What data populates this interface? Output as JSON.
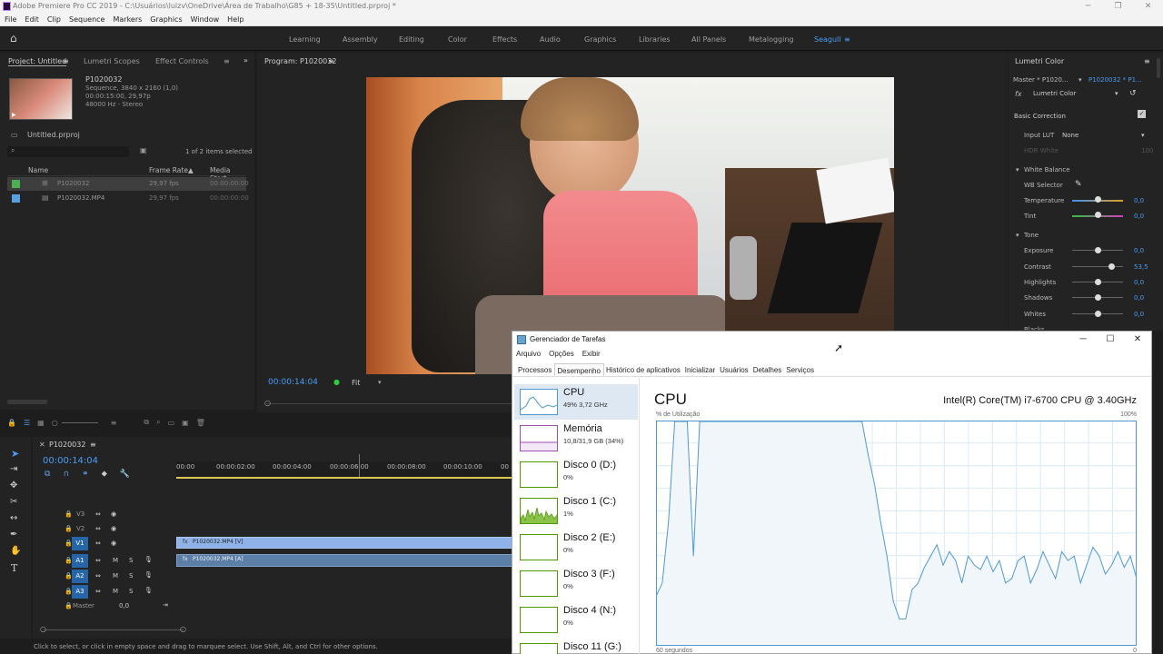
{
  "window": {
    "title": "Adobe Premiere Pro CC 2019 - C:\\Usuários\\luizv\\OneDrive\\Área de Trabalho\\G85 + 18-35\\Untitled.prproj *"
  },
  "menu": [
    "File",
    "Edit",
    "Clip",
    "Sequence",
    "Markers",
    "Graphics",
    "Window",
    "Help"
  ],
  "workspaces": [
    "Learning",
    "Assembly",
    "Editing",
    "Color",
    "Effects",
    "Audio",
    "Graphics",
    "Libraries",
    "All Panels",
    "Metalogging",
    "Seagull"
  ],
  "project": {
    "tabs": [
      "Project: Untitled",
      "Lumetri Scopes",
      "Effect Controls"
    ],
    "clip_name": "P1020032",
    "clip_info": [
      "Sequence, 3840 x 2160 (1,0)",
      "00:00:15:00, 29,97p",
      "48000 Hz - Stereo"
    ],
    "file": "Untitled.prproj",
    "items_selected": "1 of 2 items selected",
    "columns": {
      "name": "Name",
      "frame_rate": "Frame Rate",
      "media_start": "Media Start"
    },
    "rows": [
      {
        "name": "P1020032",
        "fps": "29,97 fps",
        "start": "00:00:00:00",
        "color": "#4caf50"
      },
      {
        "name": "P1020032.MP4",
        "fps": "29,97 fps",
        "start": "00:00:00:00",
        "color": "#5aa0e0"
      }
    ]
  },
  "program": {
    "tab": "Program: P1020032",
    "timecode": "00:00:14:04",
    "fit": "Fit"
  },
  "lumetri": {
    "tab": "Lumetri Color",
    "master": "Master * P1020...",
    "clip": "P1020032 * P1...",
    "fx": "Lumetri Color",
    "basic": "Basic Correction",
    "input_lut_label": "Input LUT",
    "input_lut_value": "None",
    "hdr_white": "HDR White",
    "hdr_value": "100",
    "white_balance": "White Balance",
    "wb_selector": "WB Selector",
    "temperature": {
      "label": "Temperature",
      "value": "0,0"
    },
    "tint": {
      "label": "Tint",
      "value": "0,0"
    },
    "tone": "Tone",
    "exposure": {
      "label": "Exposure",
      "value": "0,0"
    },
    "contrast": {
      "label": "Contrast",
      "value": "53,5"
    },
    "highlights": {
      "label": "Highlights",
      "value": "0,0"
    },
    "shadows": {
      "label": "Shadows",
      "value": "0,0"
    },
    "whites": {
      "label": "Whites",
      "value": "0,0"
    },
    "blacks": {
      "label": "Blacks",
      "value": ""
    }
  },
  "timeline": {
    "tab": "P1020032",
    "timecode": "00:00:14:04",
    "ruler": [
      "00:00",
      "00:00:02:00",
      "00:00:04:00",
      "00:00:06:00",
      "00:00:08:00",
      "00:00:10:00",
      "00"
    ],
    "video_tracks": [
      "V3",
      "V2",
      "V1"
    ],
    "audio_tracks": [
      "A1",
      "A2",
      "A3"
    ],
    "master": "Master",
    "master_value": "0,0",
    "video_clip": "P1020032.MP4 [V]",
    "audio_clip": "P1020032.MP4 [A]"
  },
  "status": "Click to select, or click in empty space and drag to marquee select. Use Shift, Alt, and Ctrl for other options.",
  "taskmgr": {
    "title": "Gerenciador de Tarefas",
    "menu": [
      "Arquivo",
      "Opções",
      "Exibir"
    ],
    "tabs": [
      "Processos",
      "Desempenho",
      "Histórico de aplicativos",
      "Inicializar",
      "Usuários",
      "Detalhes",
      "Serviços"
    ],
    "active_tab": 1,
    "resources": [
      {
        "name": "CPU",
        "sub": "49% 3,72 GHz",
        "color": "#4f98d1"
      },
      {
        "name": "Memória",
        "sub": "10,8/31,9 GB (34%)",
        "color": "#9b4fb0"
      },
      {
        "name": "Disco 0 (D:)",
        "sub": "0%",
        "color": "#4e9a06"
      },
      {
        "name": "Disco 1 (C:)",
        "sub": "1%",
        "color": "#4e9a06"
      },
      {
        "name": "Disco 2 (E:)",
        "sub": "0%",
        "color": "#4e9a06"
      },
      {
        "name": "Disco 3 (F:)",
        "sub": "0%",
        "color": "#4e9a06"
      },
      {
        "name": "Disco 4 (N:)",
        "sub": "0%",
        "color": "#4e9a06"
      },
      {
        "name": "Disco 11 (G:)",
        "sub": "",
        "color": "#4e9a06"
      }
    ],
    "cpu_title": "CPU",
    "cpu_model": "Intel(R) Core(TM) i7-6700 CPU @ 3.40GHz",
    "util_label": "% de Utilização",
    "max_label": "100%",
    "time_label": "60 segundos",
    "min_label": "0",
    "graph_series": [
      22,
      28,
      55,
      100,
      100,
      100,
      40,
      100,
      100,
      100,
      100,
      100,
      100,
      100,
      100,
      100,
      100,
      100,
      100,
      100,
      100,
      100,
      100,
      100,
      100,
      100,
      100,
      100,
      100,
      100,
      100,
      100,
      100,
      100,
      85,
      72,
      55,
      40,
      20,
      12,
      12,
      25,
      28,
      35,
      40,
      45,
      36,
      42,
      38,
      28,
      40,
      36,
      34,
      40,
      33,
      38,
      28,
      30,
      38,
      40,
      28,
      34,
      42,
      36,
      30,
      42,
      38,
      40,
      28,
      36,
      44,
      40,
      32,
      36,
      42,
      35,
      40,
      30
    ]
  },
  "colors": {
    "accent": "#4b9cf5",
    "cpu_line": "#4f98d1",
    "cpu_fill": "#f1f6fa",
    "video_clip": "#8fb3e8"
  }
}
